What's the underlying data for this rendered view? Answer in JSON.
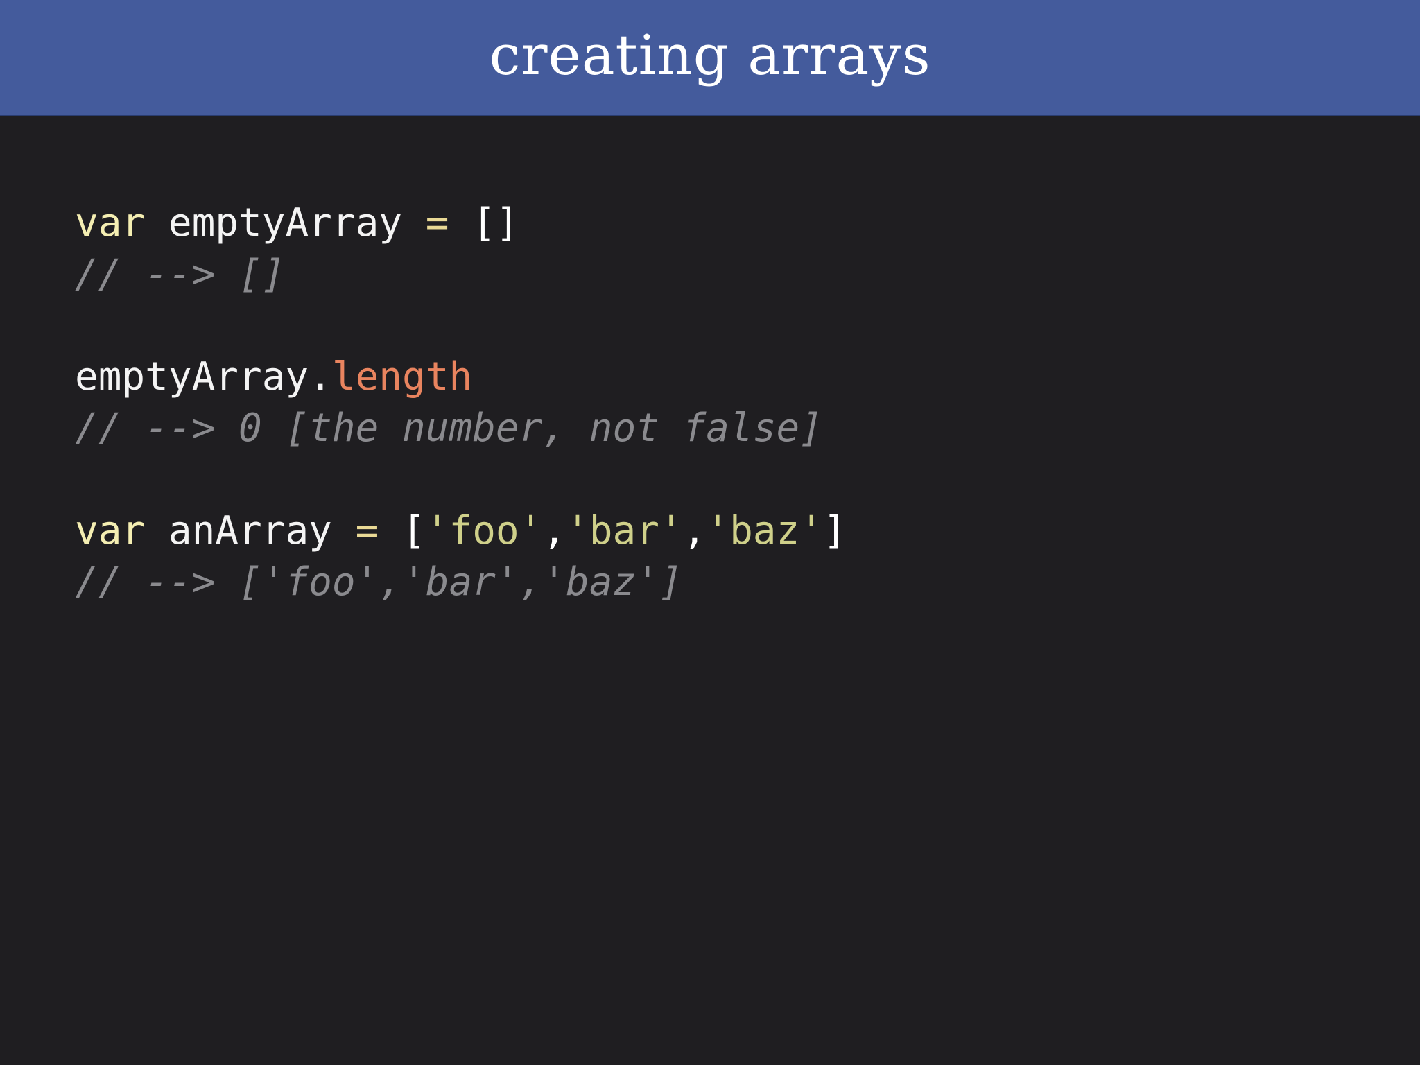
{
  "slide": {
    "title": "creating arrays",
    "colors": {
      "header_bg": "#445b9c",
      "background": "#1f1e21",
      "keyword": "#f4eeb2",
      "property": "#e9845f",
      "string": "#cfd08a",
      "comment": "#8a8a8e"
    }
  },
  "code": {
    "line1": {
      "kw": "var",
      "id": "emptyArray",
      "op": "=",
      "val": "[]"
    },
    "comment1": "// --> []",
    "line2": {
      "obj": "emptyArray.",
      "prop": "length"
    },
    "comment2": "// --> 0 [the number, not false]",
    "line3": {
      "kw": "var",
      "id": "anArray",
      "op": "=",
      "open": "[",
      "s1": "'foo'",
      "comma1": ",",
      "s2": "'bar'",
      "comma2": ",",
      "s3": "'baz'",
      "close": "]"
    },
    "comment3": "// --> ['foo','bar','baz']"
  }
}
